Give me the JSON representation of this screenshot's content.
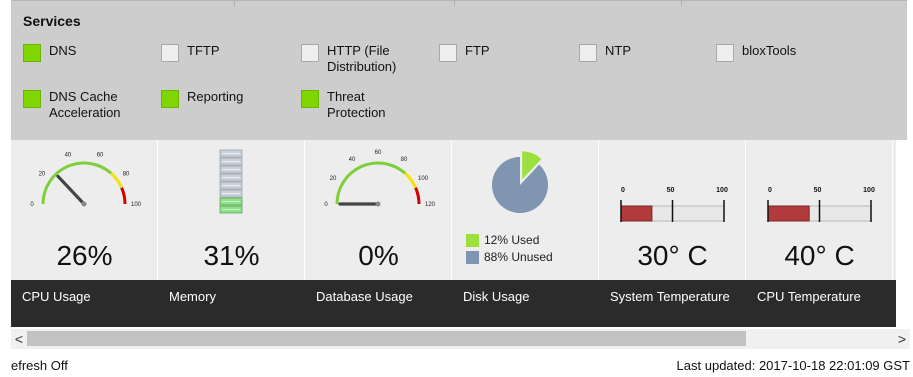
{
  "services": {
    "title": "Services",
    "items": [
      {
        "label": "DNS",
        "enabled": true
      },
      {
        "label": "TFTP",
        "enabled": false
      },
      {
        "label": "HTTP (File Distribution)",
        "enabled": false
      },
      {
        "label": "FTP",
        "enabled": false
      },
      {
        "label": "NTP",
        "enabled": false
      },
      {
        "label": "bloxTools",
        "enabled": false
      },
      {
        "label": "DNS Cache Acceleration",
        "enabled": true
      },
      {
        "label": "Reporting",
        "enabled": true
      },
      {
        "label": "Threat Protection",
        "enabled": true
      }
    ]
  },
  "widgets": {
    "cpu": {
      "value": "26%",
      "label": "CPU Usage",
      "level": 0.26,
      "gauge_ticks": [
        "0",
        "20",
        "40",
        "60",
        "80",
        "100"
      ],
      "gauge_max": 100
    },
    "memory": {
      "value": "31%",
      "label": "Memory",
      "level": 0.31
    },
    "database": {
      "value": "0%",
      "label": "Database Usage",
      "level": 0,
      "gauge_ticks": [
        "0",
        "20",
        "40",
        "60",
        "80",
        "100",
        "120"
      ],
      "gauge_max": 120
    },
    "disk": {
      "label": "Disk Usage",
      "used_label": "12% Used",
      "unused_label": "88% Unused",
      "used_fraction": 0.12,
      "used_color": "#9be03c",
      "unused_color": "#7f95b1"
    },
    "system_temp": {
      "value": "30° C",
      "label": "System Temperature",
      "level": 0.3,
      "scale_ticks": [
        "0",
        "50",
        "100"
      ]
    },
    "cpu_temp": {
      "value": "40° C",
      "label": "CPU Temperature",
      "level": 0.4,
      "scale_ticks": [
        "0",
        "50",
        "100"
      ]
    }
  },
  "scrollbar": {
    "left_arrow": "<",
    "right_arrow": ">"
  },
  "status": {
    "refresh": "efresh Off",
    "last_updated": "Last updated: 2017-10-18 22:01:09 GST"
  },
  "colors": {
    "enabled": "#7fd600",
    "gauge_green": "#7fcf3a",
    "gauge_yellow": "#f2e300",
    "gauge_red": "#d40000",
    "thermo_fill": "#b13a3a"
  }
}
